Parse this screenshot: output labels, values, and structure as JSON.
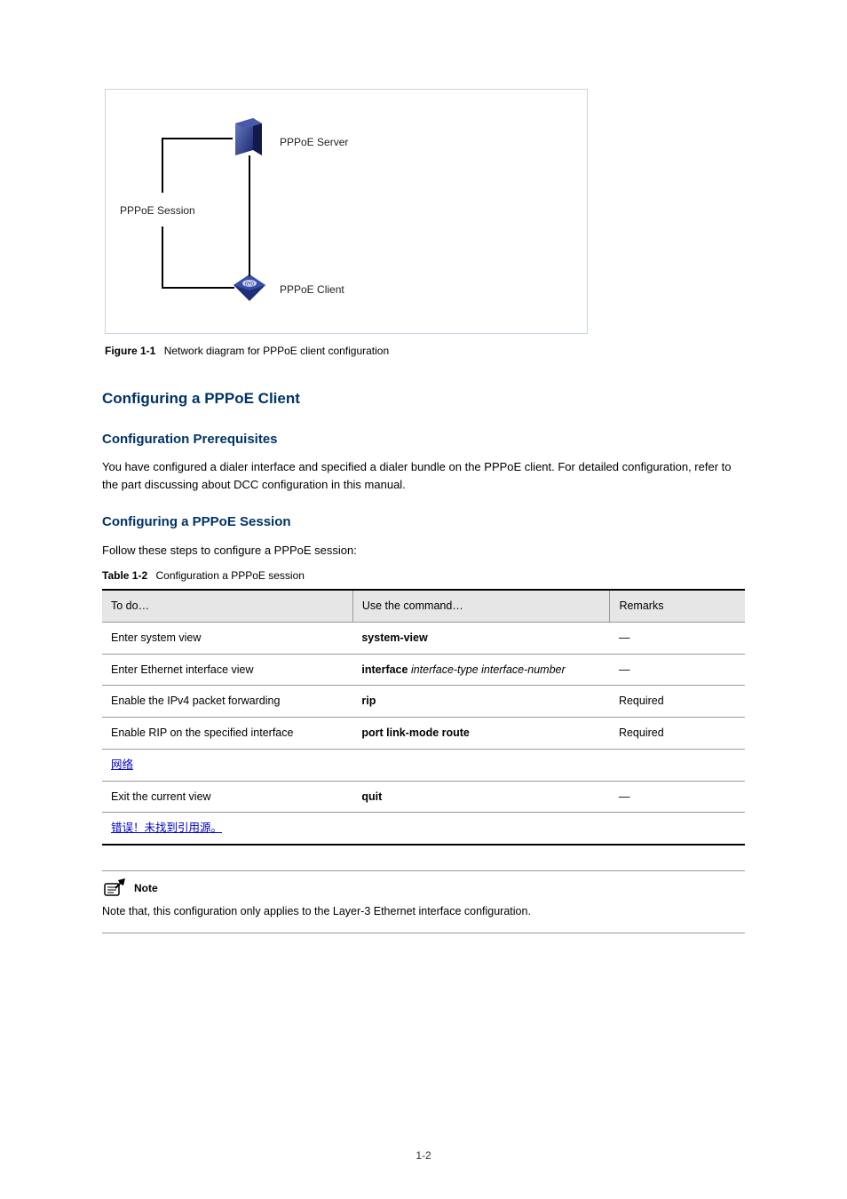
{
  "diagram": {
    "server_label": "PPPoE Server",
    "client_label": "PPPoE Client",
    "session_label": "PPPoE Session"
  },
  "figure": {
    "number": "Figure 1-1",
    "caption": "Network diagram for PPPoE client configuration"
  },
  "sections": {
    "main_heading": "Configuring a PPPoE Client",
    "sub1_heading": "Configuration Prerequisites",
    "sub1_body": "You have configured a dialer interface and specified a dialer bundle on the PPPoE client. For detailed configuration, refer to the part discussing about DCC configuration in this manual.",
    "sub2_heading": "Configuring a PPPoE Session",
    "sub2_body": "Follow these steps to configure a PPPoE session:"
  },
  "table": {
    "number": "Table 1-2",
    "caption": "Configuration a PPPoE session",
    "headers": [
      "To do…",
      "Use the command…",
      "Remarks"
    ],
    "rows": [
      {
        "todo": "Enter system view",
        "cmd": "system-view",
        "rem": "—"
      },
      {
        "todo": "Enter Ethernet interface view",
        "cmd_parts": [
          "interface ",
          "interface-type interface-number"
        ],
        "rem": "—"
      },
      {
        "todo": "Enable the IPv4 packet forwarding",
        "cmd": "rip",
        "rem": "Required"
      },
      {
        "todo": "Enable RIP on the specified interface",
        "cmd": "port link-mode route",
        "rem": "Required"
      },
      {
        "todo_ref": "网络"
      },
      {
        "todo": "Exit the current view",
        "cmd": "quit",
        "rem": "—"
      },
      {
        "todo_ref": "错误！未找到引用源。"
      }
    ]
  },
  "note": {
    "label": "Note",
    "text": "Note that, this configuration only applies to the Layer-3 Ethernet interface configuration."
  },
  "page_number": "1-2"
}
